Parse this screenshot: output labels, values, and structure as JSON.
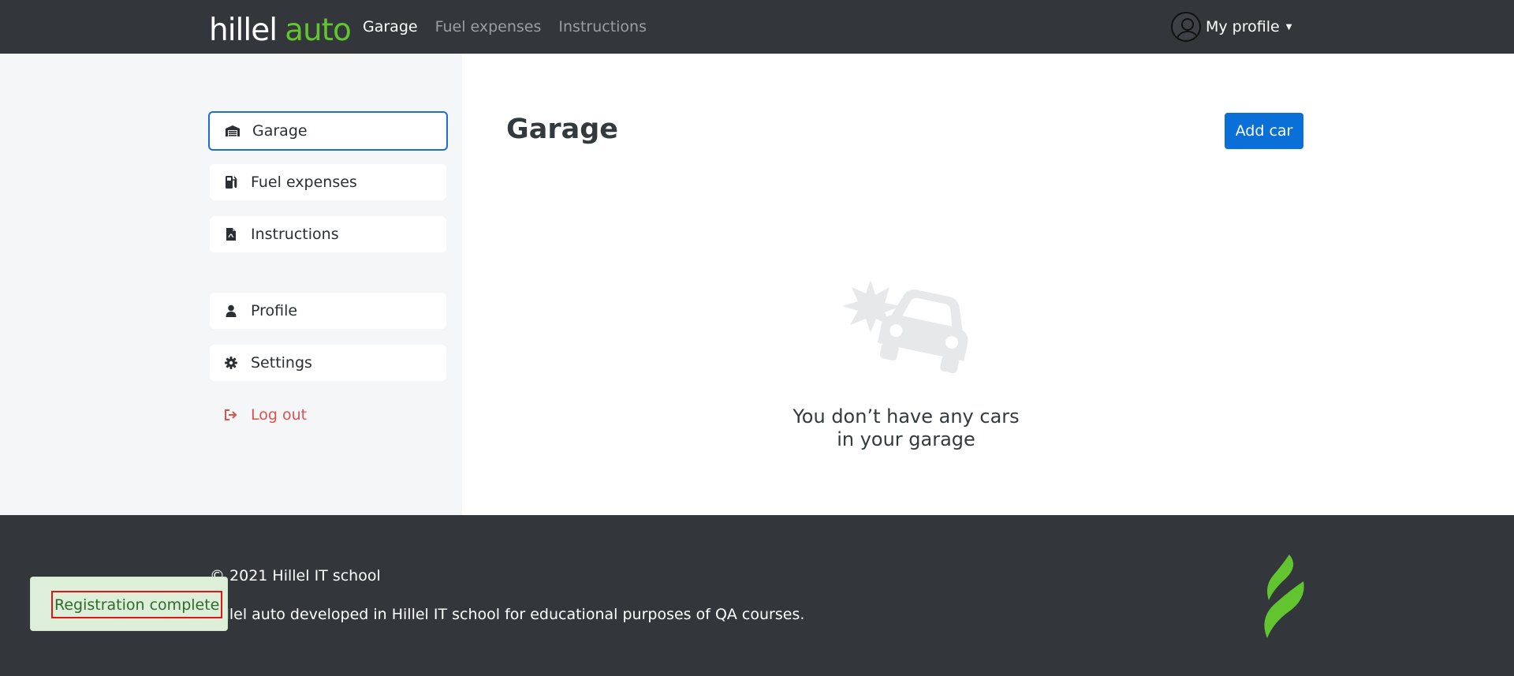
{
  "header": {
    "logo": {
      "part1": "hillel",
      "part2": "auto"
    },
    "nav": [
      "Garage",
      "Fuel expenses",
      "Instructions"
    ],
    "profile_label": "My profile"
  },
  "sidebar": {
    "items": [
      {
        "label": "Garage",
        "icon": "garage-icon"
      },
      {
        "label": "Fuel expenses",
        "icon": "fuel-icon"
      },
      {
        "label": "Instructions",
        "icon": "pdf-file-icon"
      },
      {
        "label": "Profile",
        "icon": "user-icon"
      },
      {
        "label": "Settings",
        "icon": "gear-icon"
      },
      {
        "label": "Log out",
        "icon": "logout-icon"
      }
    ]
  },
  "main": {
    "title": "Garage",
    "add_button": "Add car",
    "empty_line1": "You don’t have any cars",
    "empty_line2": "in your garage"
  },
  "footer": {
    "copyright": "© 2021 Hillel IT school",
    "description": "Hillel auto developed in Hillel IT school for educational purposes of QA courses."
  },
  "toast": {
    "message": "Registration complete"
  },
  "colors": {
    "header_bg": "#33373b",
    "brand_green": "#62c52f",
    "primary_blue": "#0b6fd8",
    "danger_red": "#d9534f",
    "toast_bg": "#ddefd8",
    "sidebar_bg": "#f5f6f8"
  }
}
